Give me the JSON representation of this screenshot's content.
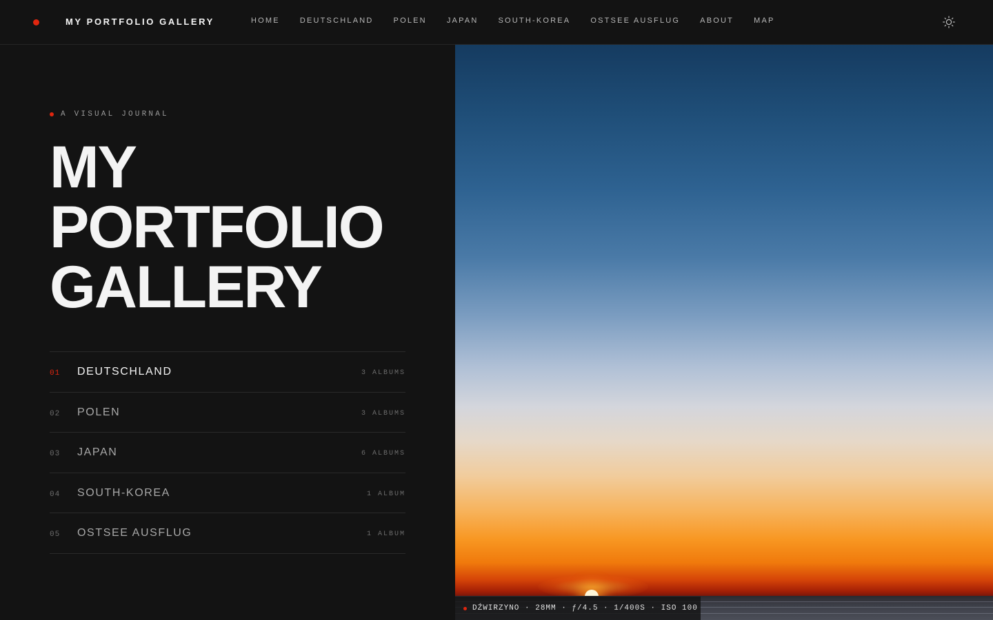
{
  "header": {
    "brand": "MY PORTFOLIO GALLERY",
    "nav": [
      "HOME",
      "DEUTSCHLAND",
      "POLEN",
      "JAPAN",
      "SOUTH-KOREA",
      "OSTSEE AUSFLUG",
      "ABOUT",
      "MAP"
    ],
    "theme_icon": "sun-icon"
  },
  "hero": {
    "eyebrow": "A VISUAL JOURNAL",
    "title_lines": [
      "MY",
      "PORTFOLIO",
      "GALLERY"
    ]
  },
  "countries": [
    {
      "num": "01",
      "name": "DEUTSCHLAND",
      "count": "3 ALBUMS",
      "active": true
    },
    {
      "num": "02",
      "name": "POLEN",
      "count": "3 ALBUMS",
      "active": false
    },
    {
      "num": "03",
      "name": "JAPAN",
      "count": "6 ALBUMS",
      "active": false
    },
    {
      "num": "04",
      "name": "SOUTH-KOREA",
      "count": "1 ALBUM",
      "active": false
    },
    {
      "num": "05",
      "name": "OSTSEE AUSFLUG",
      "count": "1 ALBUM",
      "active": false
    }
  ],
  "photo": {
    "caption": "DŹWIRZYNO · 28MM · ƒ/4.5 · 1/400S · ISO 100"
  },
  "colors": {
    "accent": "#e0260f",
    "background": "#131313"
  }
}
